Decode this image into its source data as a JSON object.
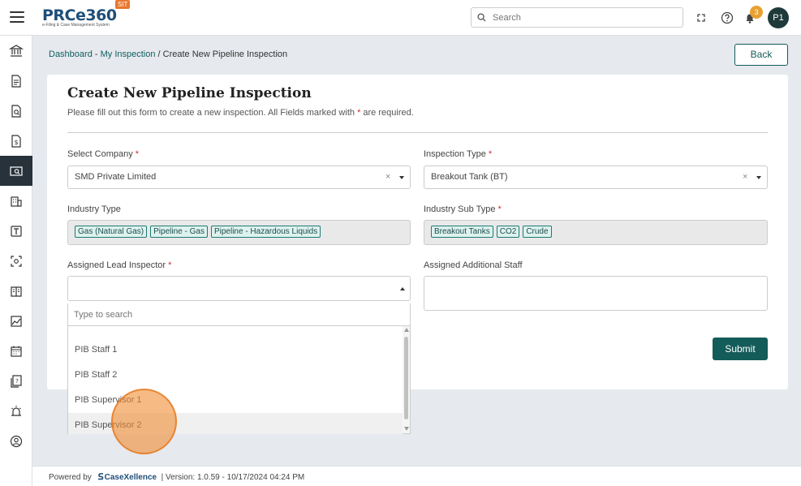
{
  "app": {
    "logo_text": "PRCe360",
    "logo_sub": "e-Filing & Case Management System",
    "env_badge": "SIT"
  },
  "header": {
    "search_placeholder": "Search",
    "notification_count": "3",
    "avatar_initials": "P1"
  },
  "breadcrumb": {
    "dashboard": "Dashboard",
    "sep1": " - ",
    "my_inspection": "My Inspection",
    "sep2": " / ",
    "current": "Create New Pipeline Inspection"
  },
  "back_label": "Back",
  "form": {
    "title": "Create New Pipeline Inspection",
    "subtitle_pre": "Please fill out this form to create a new inspection. All Fields marked with ",
    "subtitle_star": "*",
    "subtitle_post": " are required.",
    "company_label": "Select Company",
    "company_value": "SMD Private Limited",
    "inspection_type_label": "Inspection Type",
    "inspection_type_value": "Breakout Tank (BT)",
    "industry_type_label": "Industry Type",
    "industry_types": [
      "Gas (Natural Gas)",
      "Pipeline - Gas",
      "Pipeline - Hazardous Liquids"
    ],
    "industry_sub_type_label": "Industry Sub Type",
    "industry_sub_types": [
      "Breakout Tanks",
      "CO2",
      "Crude"
    ],
    "lead_inspector_label": "Assigned Lead Inspector",
    "additional_staff_label": "Assigned Additional Staff",
    "required_mark": "*",
    "submit_label": "Submit",
    "clear_symbol": "×"
  },
  "dropdown": {
    "search_placeholder": "Type to search",
    "options": [
      "PIB Staff 1",
      "PIB Staff 2",
      "PIB Supervisor 1",
      "PIB Supervisor 2"
    ]
  },
  "footer": {
    "powered_by": "Powered by",
    "brand": "CaseXellence",
    "version": "|  Version: 1.0.59 - 10/17/2024 04:24 PM"
  },
  "colors": {
    "primary": "#135c5a",
    "sidebar_active": "#27323a",
    "badge": "#e8a030",
    "required": "#d32f2f"
  },
  "icons": {
    "sidebar": [
      "bank-icon",
      "document-icon",
      "document-search-icon",
      "dollar-document-icon",
      "monitor-search-icon",
      "building-icon",
      "text-box-icon",
      "scan-icon",
      "book-icon",
      "chart-icon",
      "calendar-icon",
      "help-document-icon",
      "alarm-icon",
      "user-circle-icon"
    ]
  }
}
